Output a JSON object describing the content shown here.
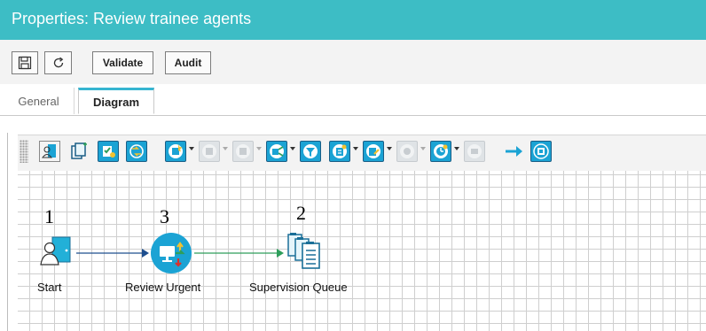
{
  "window": {
    "title": "Properties: Review trainee agents"
  },
  "toolbar": {
    "save_icon": "save-icon",
    "refresh_icon": "refresh-icon",
    "validate_label": "Validate",
    "audit_label": "Audit"
  },
  "tabs": [
    {
      "label": "General",
      "active": false
    },
    {
      "label": "Diagram",
      "active": true
    }
  ],
  "diagram_toolbar": {
    "icons": [
      "start-node-icon",
      "copy-node-icon",
      "review-node-icon",
      "merge-node-icon",
      "assign-node-icon",
      "disabled-node-icon",
      "disabled-node-icon",
      "split-node-icon",
      "filter-icon",
      "form-node-icon",
      "edit-node-icon",
      "disabled-node-icon",
      "timer-node-icon",
      "disabled-node-icon",
      "connect-arrow-icon",
      "end-node-icon"
    ]
  },
  "diagram": {
    "nodes": [
      {
        "number": "1",
        "label": "Start",
        "icon": "start-door-icon"
      },
      {
        "number": "3",
        "label": "Review Urgent",
        "icon": "review-monitor-icon"
      },
      {
        "number": "2",
        "label": "Supervision Queue",
        "icon": "queue-icon"
      }
    ],
    "connectors": [
      {
        "from": "Start",
        "to": "Review Urgent",
        "color": "#1e4f8f"
      },
      {
        "from": "Review Urgent",
        "to": "Supervision Queue",
        "color": "#2e9e5b"
      }
    ]
  },
  "colors": {
    "title_bar": "#3dbdc5",
    "accent": "#1ba3d4",
    "active_tab": "#36b5d1"
  }
}
